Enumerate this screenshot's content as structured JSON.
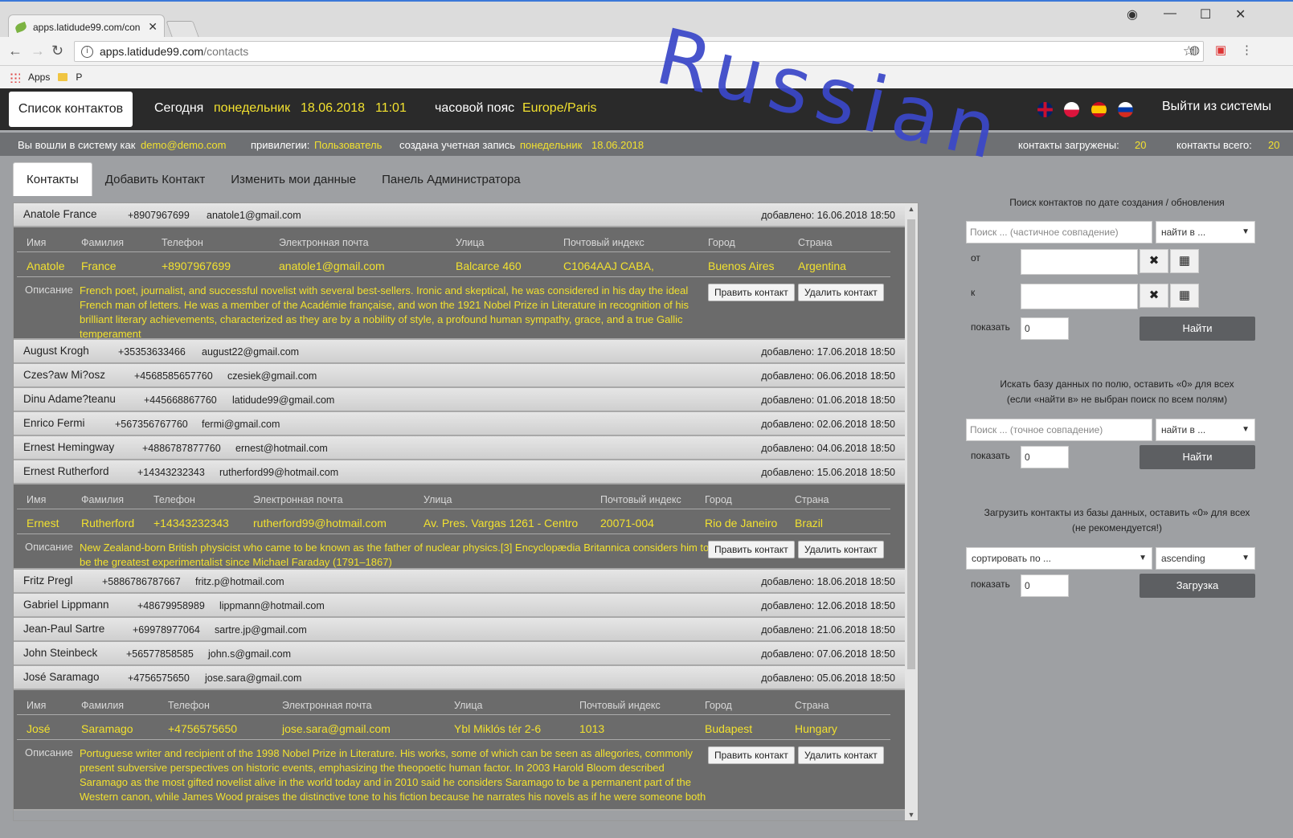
{
  "browser": {
    "tab_title": "apps.latidude99.com/con",
    "url_host": "apps.latidude99.com",
    "url_path": "/contacts",
    "bookmark_apps": "Apps",
    "bookmark_p": "P"
  },
  "watermark": "Russian",
  "header": {
    "brand": "Список контактов",
    "today_label": "Сегодня",
    "day": "понедельник",
    "date": "18.06.2018",
    "time": "11:01",
    "tz_label": "часовой пояс",
    "tz": "Europe/Paris",
    "logout": "Выйти из системы"
  },
  "infobar": {
    "logged_as": "Вы вошли в систему как",
    "email": "demo@demo.com",
    "priv_label": "привилегии:",
    "priv": "Пользователь",
    "created_label": "создана учетная запись",
    "created_day": "понедельник",
    "created_date": "18.06.2018",
    "loaded_label": "контакты загружены:",
    "loaded": "20",
    "total_label": "контакты всего:",
    "total": "20"
  },
  "tabs": [
    "Контакты",
    "Добавить Контакт",
    "Изменить мои данные",
    "Панель Администратора"
  ],
  "list": {
    "headers": {
      "first": "Имя",
      "last": "Фамилия",
      "phone": "Телефон",
      "email": "Электронная почта",
      "street": "Улица",
      "zip": "Почтовый индекс",
      "city": "Город",
      "country": "Страна",
      "desc": "Описание"
    },
    "edit_btn": "Править контакт",
    "delete_btn": "Удалить контакт",
    "rows": [
      {
        "name": "Anatole France",
        "phone": "+8907967699",
        "email": "anatole1@gmail.com",
        "added": "добавлено: 16.06.2018 18:50"
      },
      {
        "name": "August Krogh",
        "phone": "+35353633466",
        "email": "august22@gmail.com",
        "added": "добавлено: 17.06.2018 18:50"
      },
      {
        "name": "Czes?aw Mi?osz",
        "phone": "+4568585657760",
        "email": "czesiek@gmail.com",
        "added": "добавлено: 06.06.2018 18:50"
      },
      {
        "name": "Dinu Adame?teanu",
        "phone": "+445668867760",
        "email": "latidude99@gmail.com",
        "added": "добавлено: 01.06.2018 18:50"
      },
      {
        "name": "Enrico Fermi",
        "phone": "+567356767760",
        "email": "fermi@gmail.com",
        "added": "добавлено: 02.06.2018 18:50"
      },
      {
        "name": "Ernest Hemingway",
        "phone": "+4886787877760",
        "email": "ernest@hotmail.com",
        "added": "добавлено: 04.06.2018 18:50"
      },
      {
        "name": "Ernest Rutherford",
        "phone": "+14343232343",
        "email": "rutherford99@hotmail.com",
        "added": "добавлено: 15.06.2018 18:50"
      },
      {
        "name": "Fritz Pregl",
        "phone": "+5886786787667",
        "email": "fritz.p@hotmail.com",
        "added": "добавлено: 18.06.2018 18:50"
      },
      {
        "name": "Gabriel Lippmann",
        "phone": "+48679958989",
        "email": "lippmann@hotmail.com",
        "added": "добавлено: 12.06.2018 18:50"
      },
      {
        "name": "Jean-Paul Sartre",
        "phone": "+69978977064",
        "email": "sartre.jp@gmail.com",
        "added": "добавлено: 21.06.2018 18:50"
      },
      {
        "name": "John Steinbeck",
        "phone": "+56577858585",
        "email": "john.s@gmail.com",
        "added": "добавлено: 07.06.2018 18:50"
      },
      {
        "name": "José Saramago",
        "phone": "+4756575650",
        "email": "jose.sara@gmail.com",
        "added": "добавлено: 05.06.2018 18:50"
      }
    ],
    "details": [
      {
        "first": "Anatole",
        "last": "France",
        "phone": "+8907967699",
        "email": "anatole1@gmail.com",
        "street": "Balcarce 460",
        "zip": "C1064AAJ CABA,",
        "city": "Buenos Aires",
        "country": "Argentina",
        "desc": "French poet, journalist, and successful novelist with several best-sellers. Ironic and skeptical, he was considered in his day the ideal French man of letters. He was a member of the Académie française, and won the 1921 Nobel Prize in Literature in recognition of his brilliant literary achievements, characterized as they are by a nobility of style, a profound human sympathy, grace, and a true Gallic temperament"
      },
      {
        "first": "Ernest",
        "last": "Rutherford",
        "phone": "+14343232343",
        "email": "rutherford99@hotmail.com",
        "street": "Av. Pres. Vargas 1261 - Centro",
        "zip": "20071-004",
        "city": "Rio de Janeiro",
        "country": "Brazil",
        "desc": "New Zealand-born British physicist who came to be known as the father of nuclear physics.[3] Encyclopædia Britannica considers him to be the greatest experimentalist since Michael Faraday (1791–1867)"
      },
      {
        "first": "José",
        "last": "Saramago",
        "phone": "+4756575650",
        "email": "jose.sara@gmail.com",
        "street": "Ybl Miklós tér 2-6",
        "zip": "1013",
        "city": "Budapest",
        "country": "Hungary",
        "desc": "Portuguese writer and recipient of the 1998 Nobel Prize in Literature. His works, some of which can be seen as allegories, commonly present subversive perspectives on historic events, emphasizing the theopoetic human factor. In 2003 Harold Bloom described Saramago as the most gifted novelist alive in the world today and in 2010 said he considers Saramago to be a permanent part of the Western canon, while James Wood praises the distinctive tone to his fiction because he narrates his novels as if he were someone both"
      }
    ]
  },
  "search": {
    "date_title": "Поиск контактов по дате создания / обновления",
    "date_placeholder": "Поиск ... (частичное совпадение)",
    "find_in": "найти в ...",
    "from_label": "от",
    "to_label": "к",
    "show_label": "показать",
    "show_value": "0",
    "find_btn": "Найти",
    "field_title_1": "Искать базу данных по полю, оставить «0» для всех",
    "field_title_2": "(если «найти в» не выбран поиск по всем полям)",
    "field_placeholder": "Поиск ... (точное совпадение)",
    "load_title_1": "Загрузить контакты из базы данных, оставить «0» для всех",
    "load_title_2": "(не рекомендуется!)",
    "sort_by": "сортировать по ...",
    "order": "ascending",
    "load_btn": "Загрузка"
  },
  "icons": {
    "clear": "clear-x-icon",
    "calendar": "calendar-grid-icon",
    "flags": [
      "uk-flag-icon",
      "poland-flag-icon",
      "spain-flag-icon",
      "russia-flag-icon"
    ]
  },
  "colors": {
    "accent_yellow": "#f2e12f",
    "header_dark": "#2a2a2a",
    "watermark": "#3b48c9"
  }
}
